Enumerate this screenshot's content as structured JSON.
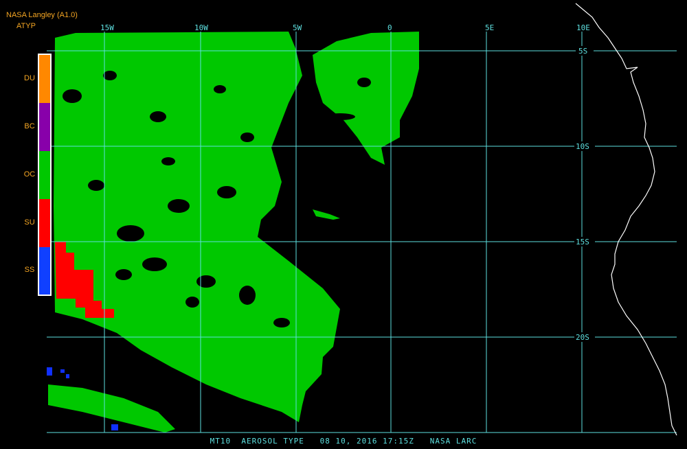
{
  "header": {
    "source": "NASA Langley (A1.0)",
    "product": "ATYP"
  },
  "caption": "MT10  AEROSOL TYPE   08 10, 2016 17:15Z   NASA LARC",
  "legend": {
    "items": [
      {
        "code": "DU",
        "color": "#ff8800"
      },
      {
        "code": "BC",
        "color": "#8800aa"
      },
      {
        "code": "OC",
        "color": "#00c800"
      },
      {
        "code": "SU",
        "color": "#ff0000"
      },
      {
        "code": "SS",
        "color": "#1040ff"
      }
    ]
  },
  "grid": {
    "color": "#5ee0e0",
    "longitude_labels": [
      "15W",
      "10W",
      "5W",
      "0",
      "5E",
      "10E"
    ],
    "latitude_labels": [
      "5S",
      "10S",
      "15S",
      "20S"
    ]
  },
  "colors": {
    "background": "#000000",
    "coastline": "#ffffff",
    "label_orange": "#f5a623"
  }
}
